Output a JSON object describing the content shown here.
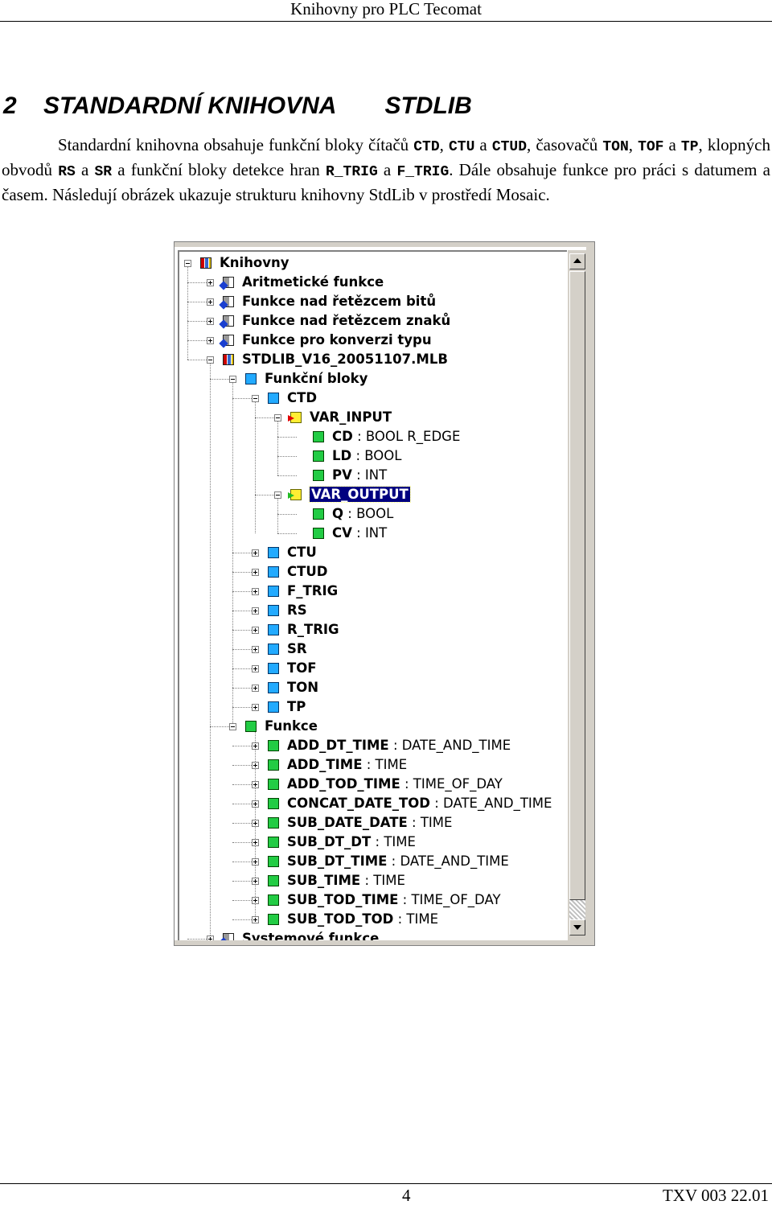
{
  "header": {
    "running_title": "Knihovny pro PLC Tecomat"
  },
  "section": {
    "number": "2",
    "title_part1": "STANDARDNÍ KNIHOVNA",
    "title_part2": "STDLIB"
  },
  "paragraph": {
    "t1": "Standardní knihovna obsahuje funkční bloky čítačů ",
    "m1": "CTD",
    "t2": ", ",
    "m2": "CTU",
    "t3": " a ",
    "m3": "CTUD",
    "t4": ", časovačů ",
    "m4": "TON",
    "t5": ", ",
    "m5": "TOF",
    "t6": " a ",
    "m6": "TP",
    "t7": ", klopných obvodů ",
    "m7": "RS",
    "t8": " a ",
    "m8": "SR",
    "t9": " a funkční bloky detekce hran ",
    "m9": "R_TRIG",
    "t10": " a ",
    "m10": "F_TRIG",
    "t11": ". Dále obsahuje funkce pro práci s datumem a časem. Následují obrázek ukazuje strukturu knihovny StdLib v prostředí Mosaic."
  },
  "tree": {
    "rows": [
      {
        "label": "Knihovny",
        "type": "",
        "icon": "lib-icon"
      },
      {
        "label": "Aritmetické funkce",
        "type": "",
        "icon": "library-star-icon"
      },
      {
        "label": "Funkce nad řetězcem bitů",
        "type": "",
        "icon": "library-star-icon"
      },
      {
        "label": "Funkce nad řetězcem znaků",
        "type": "",
        "icon": "library-star-icon"
      },
      {
        "label": "Funkce pro konverzi typu",
        "type": "",
        "icon": "library-star-icon"
      },
      {
        "label": "STDLIB_V16_20051107.MLB",
        "type": "",
        "icon": "library-icon"
      },
      {
        "label": "Funkční bloky",
        "type": "",
        "icon": "function-block-folder-icon"
      },
      {
        "label": "CTD",
        "type": "",
        "icon": "function-block-icon"
      },
      {
        "label": "VAR_INPUT",
        "type": "",
        "icon": "var-input-icon"
      },
      {
        "label": "CD",
        "type": ": BOOL R_EDGE",
        "icon": "variable-icon"
      },
      {
        "label": "LD",
        "type": ": BOOL",
        "icon": "variable-icon"
      },
      {
        "label": "PV",
        "type": ": INT",
        "icon": "variable-icon"
      },
      {
        "label": "VAR_OUTPUT",
        "type": "",
        "icon": "var-output-icon"
      },
      {
        "label": "Q",
        "type": ": BOOL",
        "icon": "variable-icon"
      },
      {
        "label": "CV",
        "type": ": INT",
        "icon": "variable-icon"
      },
      {
        "label": "CTU",
        "type": "",
        "icon": "function-block-icon"
      },
      {
        "label": "CTUD",
        "type": "",
        "icon": "function-block-icon"
      },
      {
        "label": "F_TRIG",
        "type": "",
        "icon": "function-block-icon"
      },
      {
        "label": "RS",
        "type": "",
        "icon": "function-block-icon"
      },
      {
        "label": "R_TRIG",
        "type": "",
        "icon": "function-block-icon"
      },
      {
        "label": "SR",
        "type": "",
        "icon": "function-block-icon"
      },
      {
        "label": "TOF",
        "type": "",
        "icon": "function-block-icon"
      },
      {
        "label": "TON",
        "type": "",
        "icon": "function-block-icon"
      },
      {
        "label": "TP",
        "type": "",
        "icon": "function-block-icon"
      },
      {
        "label": "Funkce",
        "type": "",
        "icon": "function-folder-icon"
      },
      {
        "label": "ADD_DT_TIME",
        "type": ": DATE_AND_TIME",
        "icon": "function-icon"
      },
      {
        "label": "ADD_TIME",
        "type": ": TIME",
        "icon": "function-icon"
      },
      {
        "label": "ADD_TOD_TIME",
        "type": ": TIME_OF_DAY",
        "icon": "function-icon"
      },
      {
        "label": "CONCAT_DATE_TOD",
        "type": ": DATE_AND_TIME",
        "icon": "function-icon"
      },
      {
        "label": "SUB_DATE_DATE",
        "type": ": TIME",
        "icon": "function-icon"
      },
      {
        "label": "SUB_DT_DT",
        "type": ": TIME",
        "icon": "function-icon"
      },
      {
        "label": "SUB_DT_TIME",
        "type": ": DATE_AND_TIME",
        "icon": "function-icon"
      },
      {
        "label": "SUB_TIME",
        "type": ": TIME",
        "icon": "function-icon"
      },
      {
        "label": "SUB_TOD_TIME",
        "type": ": TIME_OF_DAY",
        "icon": "function-icon"
      },
      {
        "label": "SUB_TOD_TOD",
        "type": ": TIME",
        "icon": "function-icon"
      },
      {
        "label": "Systemové funkce",
        "type": "",
        "icon": "library-star-icon"
      }
    ]
  },
  "footer": {
    "page_number": "4",
    "doc_code": "TXV 003 22.01"
  }
}
